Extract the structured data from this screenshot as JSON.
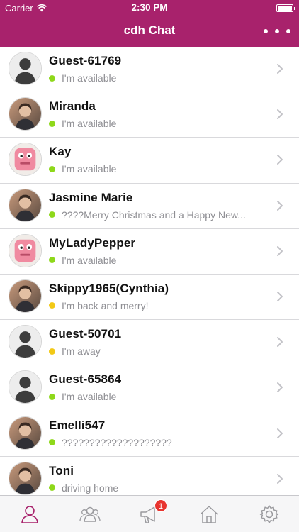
{
  "status_bar": {
    "carrier": "Carrier",
    "time": "2:30 PM",
    "battery_level": 1.0
  },
  "nav": {
    "title": "cdh Chat",
    "more_icon": "ellipsis-icon"
  },
  "contacts": [
    {
      "name": "Guest-61769",
      "status": "I'm available",
      "presence": "available",
      "avatar": "silhouette"
    },
    {
      "name": "Miranda",
      "status": "I'm available",
      "presence": "available",
      "avatar": "photo"
    },
    {
      "name": "Kay",
      "status": "I'm available",
      "presence": "available",
      "avatar": "pink-cartoon"
    },
    {
      "name": "Jasmine Marie",
      "status": "????Merry Christmas and a Happy New...",
      "presence": "available",
      "avatar": "photo"
    },
    {
      "name": "MyLadyPepper",
      "status": "I'm available",
      "presence": "available",
      "avatar": "pink-cartoon"
    },
    {
      "name": "Skippy1965(Cynthia)",
      "status": "I'm back and merry!",
      "presence": "away",
      "avatar": "photo"
    },
    {
      "name": "Guest-50701",
      "status": "I'm away",
      "presence": "away",
      "avatar": "silhouette"
    },
    {
      "name": "Guest-65864",
      "status": "I'm available",
      "presence": "available",
      "avatar": "silhouette"
    },
    {
      "name": "Emelli547",
      "status": "????????????????????",
      "presence": "available",
      "avatar": "photo"
    },
    {
      "name": "Toni",
      "status": "driving home",
      "presence": "available",
      "avatar": "photo"
    }
  ],
  "tabs": [
    {
      "icon": "person-icon",
      "active": true,
      "badge": ""
    },
    {
      "icon": "group-icon",
      "active": false,
      "badge": ""
    },
    {
      "icon": "megaphone-icon",
      "active": false,
      "badge": "1"
    },
    {
      "icon": "home-icon",
      "active": false,
      "badge": ""
    },
    {
      "icon": "gear-icon",
      "active": false,
      "badge": ""
    }
  ],
  "colors": {
    "brand": "#a8226c",
    "available": "#8ed81a",
    "away": "#f2c916",
    "badge": "#e8342f"
  }
}
